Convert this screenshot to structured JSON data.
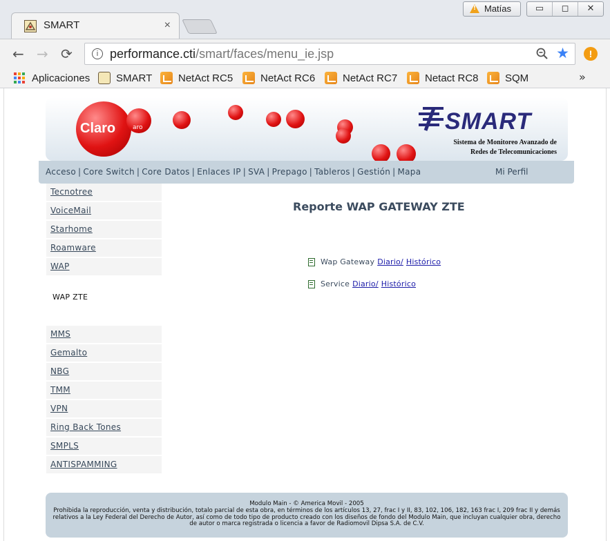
{
  "browser": {
    "tab_title": "SMART",
    "tab_close": "×",
    "profile_name": "Matías",
    "window_buttons": [
      "▭",
      "◻",
      "✕"
    ],
    "nav": {
      "back": "←",
      "forward": "→",
      "reload": "⟳"
    },
    "url": {
      "host": "performance.cti",
      "path": "/smart/faces/menu_ie.jsp"
    },
    "info_icon": "i",
    "ext_icon": "!",
    "bookmarks": [
      {
        "label": "Aplicaciones",
        "icon": "apps-grid-icon"
      },
      {
        "label": "SMART",
        "icon": "smart-favicon-icon"
      },
      {
        "label": "NetAct RC5",
        "icon": "netact-icon"
      },
      {
        "label": "NetAct RC6",
        "icon": "netact-icon"
      },
      {
        "label": "NetAct RC7",
        "icon": "netact-icon"
      },
      {
        "label": "Netact RC8",
        "icon": "netact-icon"
      },
      {
        "label": "SQM",
        "icon": "netact-icon"
      }
    ],
    "bookmarks_more": "»"
  },
  "banner": {
    "claro": "Claro",
    "claro_small": "aro",
    "smart": "SMART",
    "subtitle_line1": "Sistema de Monitoreo Avanzado de",
    "subtitle_line2": "Redes de Telecomunicaciones"
  },
  "menu": {
    "items": [
      "Acceso",
      "Core Switch",
      "Core Datos",
      "Enlaces IP",
      "SVA",
      "Prepago",
      "Tableros",
      "Gestión",
      "Mapa"
    ],
    "profile": "Mi Perfil"
  },
  "sidebar": {
    "top_items": [
      "Tecnotree",
      "VoiceMail",
      "Starhome",
      "Roamware",
      "WAP"
    ],
    "current": "WAP ZTE",
    "bottom_items": [
      "MMS",
      "Gemalto",
      "NBG",
      "TMM",
      "VPN",
      "Ring Back Tones",
      "SMPLS",
      "ANTISPAMMING"
    ]
  },
  "report": {
    "title": "Reporte WAP GATEWAY ZTE",
    "rows": [
      {
        "label": "Wap Gateway",
        "daily": "Diario/",
        "historic": "Histórico"
      },
      {
        "label": "Service",
        "daily": "Diario/",
        "historic": "Histórico"
      }
    ]
  },
  "footer": {
    "line1": "Modulo Main - © America Movil - 2005",
    "line2": "Prohibida la reproducción, venta y distribución, totalo parcial de esta obra, en términos de los artículos 13, 27, frac I y II, 83, 102, 106, 182, 163 frac I, 209 frac II y demás relativos a la Ley Federal del Derecho de Autor, así como de todo tipo de producto creado con los diseños de fondo del Modulo Main, que incluyan cualquier obra, derecho de autor o marca registrada o licencia a favor de Radiomovil Dipsa S.A. de C.V."
  },
  "colors": {
    "menubar": "#c6d3dd",
    "link": "#1a1aa8",
    "text": "#3b4b5e",
    "claro_red": "#e01313",
    "smart_blue": "#2a2a7a"
  }
}
